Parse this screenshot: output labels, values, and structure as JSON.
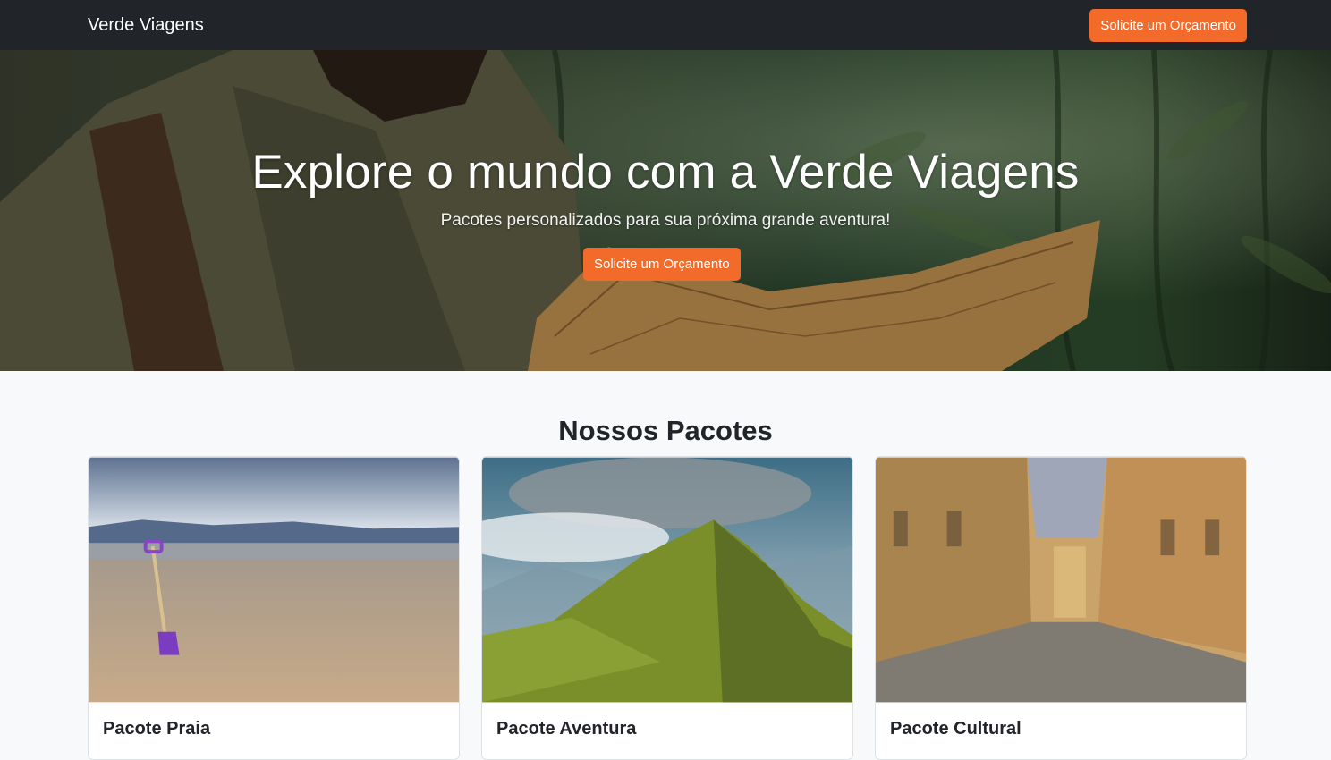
{
  "navbar": {
    "brand": "Verde Viagens",
    "cta_label": "Solicite um Orçamento"
  },
  "hero": {
    "title": "Explore o mundo com a Verde Viagens",
    "subtitle": "Pacotes personalizados para sua próxima grande aventura!",
    "cta_label": "Solicite um Orçamento"
  },
  "packages": {
    "heading": "Nossos Pacotes",
    "cards": [
      {
        "title": "Pacote Praia",
        "image": "beach-shovel-photo"
      },
      {
        "title": "Pacote Aventura",
        "image": "mountain-ridge-photo"
      },
      {
        "title": "Pacote Cultural",
        "image": "historic-street-photo"
      }
    ]
  },
  "colors": {
    "navbar_bg": "#212529",
    "accent": "#f26b2a",
    "page_bg": "#f8f9fa"
  }
}
